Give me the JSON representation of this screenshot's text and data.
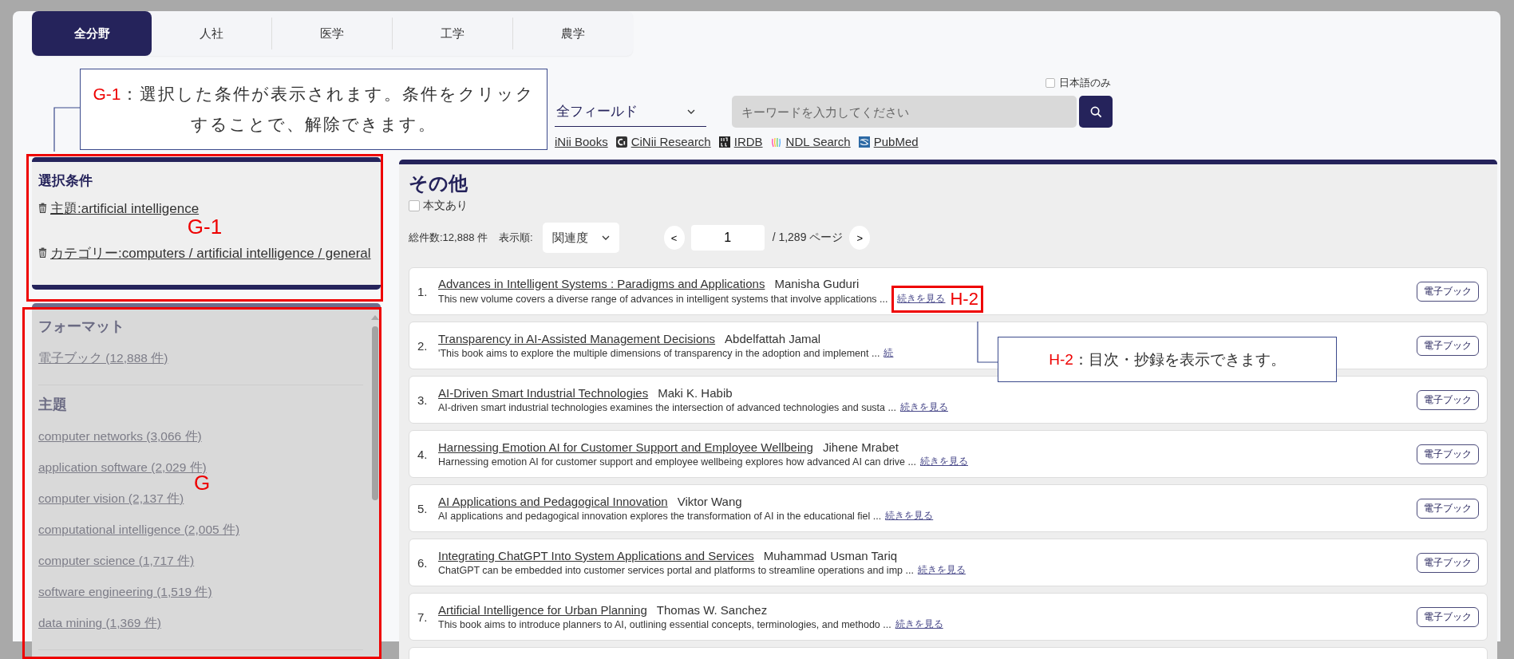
{
  "tabs": [
    {
      "label": "全分野",
      "selected": true
    },
    {
      "label": "人社",
      "selected": false
    },
    {
      "label": "医学",
      "selected": false
    },
    {
      "label": "工学",
      "selected": false
    },
    {
      "label": "農学",
      "selected": false
    }
  ],
  "search": {
    "field": "全フィールド",
    "placeholder": "キーワードを入力してください",
    "japanese_only": {
      "label": "日本語のみ",
      "checked": false
    }
  },
  "sources": [
    {
      "label": "iNii Books"
    },
    {
      "label": "CiNii Research",
      "kind": "cinii"
    },
    {
      "label": "IRDB",
      "kind": "irdb"
    },
    {
      "label": "NDL Search",
      "kind": "ndl"
    },
    {
      "label": "PubMed",
      "kind": "pubmed"
    }
  ],
  "selected_conditions": {
    "title": "選択条件",
    "items": [
      "主題:artificial intelligence",
      "カテゴリー:computers / artificial intelligence / general"
    ]
  },
  "facets": [
    {
      "title": "フォーマット",
      "items": [
        "電子ブック (12,888 件)"
      ]
    },
    {
      "title": "主題",
      "items": [
        "computer networks (3,066 件)",
        "application software (2,029 件)",
        "computer vision (2,137 件)",
        "computational intelligence (2,005 件)",
        "computer science (1,717 件)",
        "software engineering (1,519 件)",
        "data mining (1,369 件)"
      ]
    }
  ],
  "results": {
    "title": "その他",
    "fulltext_only": {
      "label": "本文あり",
      "checked": false
    },
    "total": "総件数:12,888 件",
    "sort_label": "表示順:",
    "sort": "関連度",
    "prev": "<",
    "page": "1",
    "pages": "/ 1,289 ページ",
    "next": ">",
    "items": [
      {
        "number": "1.",
        "title": "Advances in Intelligent Systems : Paradigms and Applications",
        "author": "Manisha Guduri",
        "summary": "This new volume covers a diverse range of advances in intelligent systems that involve applications ...",
        "more": "続きを見る",
        "badge": "電子ブック"
      },
      {
        "number": "2.",
        "title": "Transparency in AI-Assisted Management Decisions",
        "author": "Abdelfattah Jamal",
        "summary": "'This book aims to explore the multiple dimensions of transparency in the adoption and implement ...",
        "more": "続",
        "badge": "電子ブック"
      },
      {
        "number": "3.",
        "title": "AI-Driven Smart Industrial Technologies",
        "author": "Maki K. Habib",
        "summary": "AI-driven smart industrial technologies examines the intersection of advanced technologies and susta ...",
        "more": "続きを見る",
        "badge": "電子ブック"
      },
      {
        "number": "4.",
        "title": "Harnessing Emotion AI for Customer Support and Employee Wellbeing",
        "author": "Jihene Mrabet",
        "summary": "Harnessing emotion AI for customer support and employee wellbeing explores how advanced AI can drive ...",
        "more": "続きを見る",
        "badge": "電子ブック"
      },
      {
        "number": "5.",
        "title": "AI Applications and Pedagogical Innovation",
        "author": "Viktor Wang",
        "summary": "AI applications and pedagogical innovation explores the transformation of AI in the educational fiel ...",
        "more": "続きを見る",
        "badge": "電子ブック"
      },
      {
        "number": "6.",
        "title": "Integrating ChatGPT Into System Applications and Services",
        "author": "Muhammad Usman Tariq",
        "summary": "ChatGPT can be embedded into customer services portal and platforms to streamline operations and imp ...",
        "more": "続きを見る",
        "badge": "電子ブック"
      },
      {
        "number": "7.",
        "title": "Artificial Intelligence for Urban Planning",
        "author": "Thomas W. Sanchez",
        "summary": "This book aims to introduce planners to AI, outlining essential concepts, terminologies, and methodo ...",
        "more": "続きを見る",
        "badge": "電子ブック"
      }
    ]
  },
  "callouts": [
    {
      "label": "G-1",
      "text": "：選択した条件が表示されます。条件をクリックすることで、解除できます。"
    },
    {
      "label": "H-2",
      "text": "：目次・抄録を表示できます。"
    }
  ],
  "frame_labels": [
    "G-1",
    "G",
    "H-2"
  ]
}
